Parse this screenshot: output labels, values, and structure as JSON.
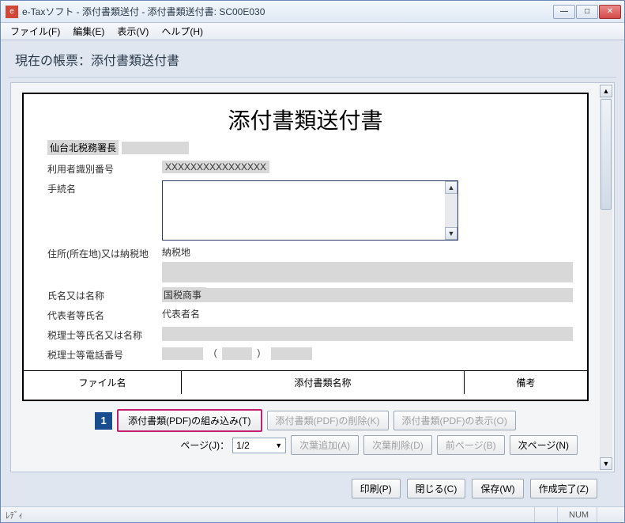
{
  "window": {
    "title": "e-Taxソフト - 添付書類送付 - 添付書類送付書: SC00E030"
  },
  "menubar": {
    "file": "ファイル(F)",
    "edit": "編集(E)",
    "view": "表示(V)",
    "help": "ヘルプ(H)"
  },
  "subtitle": "現在の帳票：添付書類送付書",
  "callout": "1",
  "doc": {
    "title": "添付書類送付書",
    "taxOffice": "仙台北税務署長",
    "labels": {
      "userId": "利用者識別番号",
      "procedure": "手続名",
      "address": "住所(所在地)又は納税地",
      "addressValue": "納税地",
      "name": "氏名又は名称",
      "nameValue": "国税商事",
      "repName": "代表者等氏名",
      "repValue": "代表者名",
      "accountant": "税理士等氏名又は名称",
      "accountantTel": "税理士等電話番号"
    },
    "userIdValue": "XXXXXXXXXXXXXXXX",
    "table": {
      "col1": "ファイル名",
      "col2": "添付書類名称",
      "col3": "備考"
    }
  },
  "controls": {
    "importPdf": "添付書類(PDF)の組み込み(T)",
    "deletePdf": "添付書類(PDF)の削除(K)",
    "viewPdf": "添付書類(PDF)の表示(O)",
    "pageLabel": "ページ(J)：",
    "pageValue": "1/2",
    "addPage": "次葉追加(A)",
    "delPage": "次葉削除(D)",
    "prevPage": "前ページ(B)",
    "nextPage": "次ページ(N)",
    "print": "印刷(P)",
    "close": "閉じる(C)",
    "save": "保存(W)",
    "finish": "作成完了(Z)"
  },
  "statusbar": {
    "ready": "ﾚﾃﾞｨ",
    "num": "NUM"
  }
}
